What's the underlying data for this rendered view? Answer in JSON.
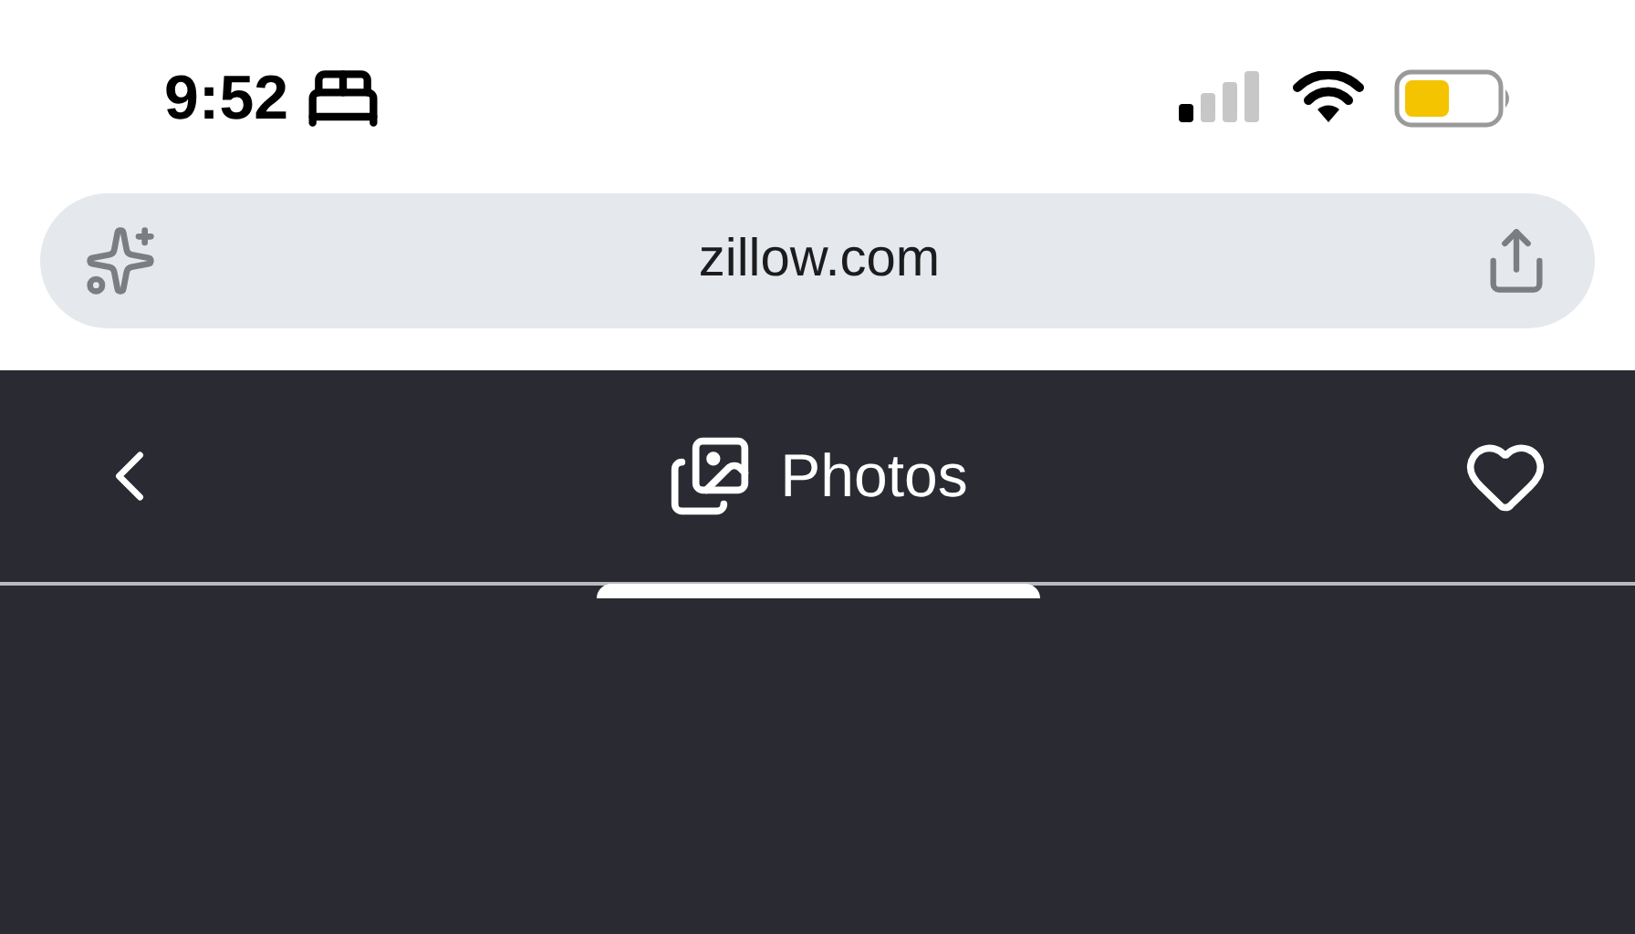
{
  "status_bar": {
    "time": "9:52"
  },
  "address_bar": {
    "url": "zillow.com"
  },
  "header": {
    "tabs": [
      {
        "label": "Photos",
        "selected": true
      }
    ]
  }
}
